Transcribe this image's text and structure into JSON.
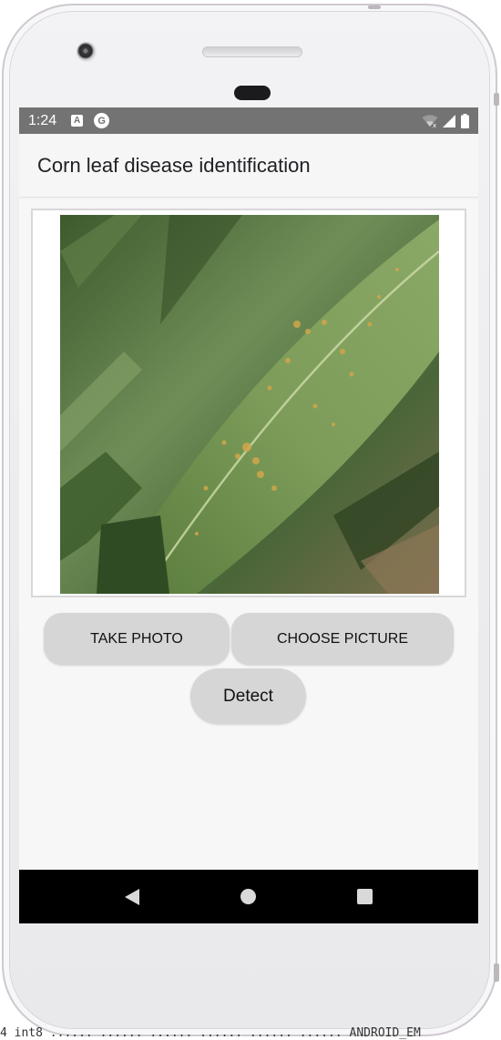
{
  "status_bar": {
    "time": "1:24",
    "icons": [
      "a-notification-icon",
      "g-notification-icon",
      "wifi-icon",
      "signal-icon",
      "battery-icon"
    ],
    "a_icon_text": "A",
    "g_icon_text": "G"
  },
  "app_bar": {
    "title": "Corn leaf disease identification"
  },
  "image": {
    "subject": "corn leaf with orange rust spots"
  },
  "buttons": {
    "take_photo": "TAKE PHOTO",
    "choose_picture": "CHOOSE PICTURE",
    "detect": "Detect"
  },
  "nav_bar": {
    "icons": [
      "back-icon",
      "home-icon",
      "recents-icon"
    ]
  },
  "terminal_fragment": "4 int8 ...... ...... ...... ...... ...... ...... ANDROID_EM"
}
